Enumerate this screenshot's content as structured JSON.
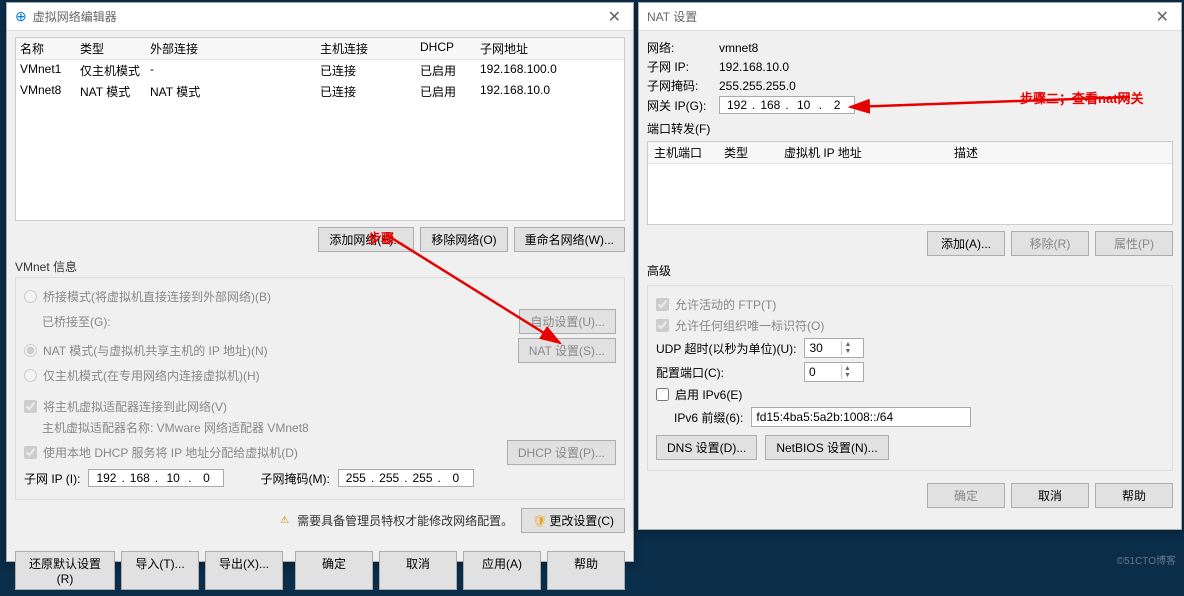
{
  "left": {
    "title": "虚拟网络编辑器",
    "columns": {
      "name": "名称",
      "type": "类型",
      "ext": "外部连接",
      "host": "主机连接",
      "dhcp": "DHCP",
      "subnet": "子网地址"
    },
    "rows": [
      {
        "name": "VMnet1",
        "type": "仅主机模式",
        "ext": "-",
        "host": "已连接",
        "dhcp": "已启用",
        "subnet": "192.168.100.0"
      },
      {
        "name": "VMnet8",
        "type": "NAT 模式",
        "ext": "NAT 模式",
        "host": "已连接",
        "dhcp": "已启用",
        "subnet": "192.168.10.0"
      }
    ],
    "btn_add": "添加网络(E)...",
    "btn_remove": "移除网络(O)",
    "btn_rename": "重命名网络(W)...",
    "info_label": "VMnet 信息",
    "radio_bridge": "桥接模式(将虚拟机直接连接到外部网络)(B)",
    "bridge_to_lbl": "已桥接至(G):",
    "bridge_auto": "自动设置(U)...",
    "radio_nat": "NAT 模式(与虚拟机共享主机的 IP 地址)(N)",
    "nat_settings": "NAT 设置(S)...",
    "radio_host": "仅主机模式(在专用网络内连接虚拟机)(H)",
    "chk_hostconn": "将主机虚拟适配器连接到此网络(V)",
    "host_adapter_label": "主机虚拟适配器名称: VMware 网络适配器 VMnet8",
    "chk_dhcp": "使用本地 DHCP 服务将 IP 地址分配给虚拟机(D)",
    "dhcp_settings": "DHCP 设置(P)...",
    "subnet_ip_lbl": "子网 IP (I):",
    "subnet_ip": [
      "192",
      "168",
      "10",
      "0"
    ],
    "subnet_mask_lbl": "子网掩码(M):",
    "subnet_mask": [
      "255",
      "255",
      "255",
      "0"
    ],
    "warn_text": "需要具备管理员特权才能修改网络配置。",
    "change_settings": "更改设置(C)",
    "restore": "还原默认设置(R)",
    "import": "导入(T)...",
    "export": "导出(X)...",
    "ok": "确定",
    "cancel": "取消",
    "apply": "应用(A)",
    "help": "帮助"
  },
  "right": {
    "title": "NAT 设置",
    "net_lbl": "网络:",
    "net": "vmnet8",
    "sub_lbl": "子网 IP:",
    "sub": "192.168.10.0",
    "mask_lbl": "子网掩码:",
    "mask": "255.255.255.0",
    "gw_lbl": "网关 IP(G):",
    "gw": [
      "192",
      "168",
      "10",
      "2"
    ],
    "pf_lbl": "端口转发(F)",
    "pf_cols": {
      "hp": "主机端口",
      "type": "类型",
      "vip": "虚拟机 IP 地址",
      "desc": "描述"
    },
    "pf_add": "添加(A)...",
    "pf_remove": "移除(R)",
    "pf_prop": "属性(P)",
    "adv_lbl": "高级",
    "chk_ftp": "允许活动的 FTP(T)",
    "chk_ident": "允许任何组织唯一标识符(O)",
    "udp_lbl": "UDP 超时(以秒为单位)(U):",
    "udp_val": "30",
    "cfg_port_lbl": "配置端口(C):",
    "cfg_port_val": "0",
    "chk_ipv6": "启用 IPv6(E)",
    "ipv6_prefix_lbl": "IPv6 前缀(6):",
    "ipv6_prefix": "fd15:4ba5:5a2b:1008::/64",
    "dns_btn": "DNS 设置(D)...",
    "netbios_btn": "NetBIOS 设置(N)...",
    "ok": "确定",
    "cancel": "取消",
    "help": "帮助"
  },
  "annotations": {
    "step1": "步骤",
    "step2": "步骤二；查看nat网关"
  },
  "watermark": "©51CTO博客"
}
